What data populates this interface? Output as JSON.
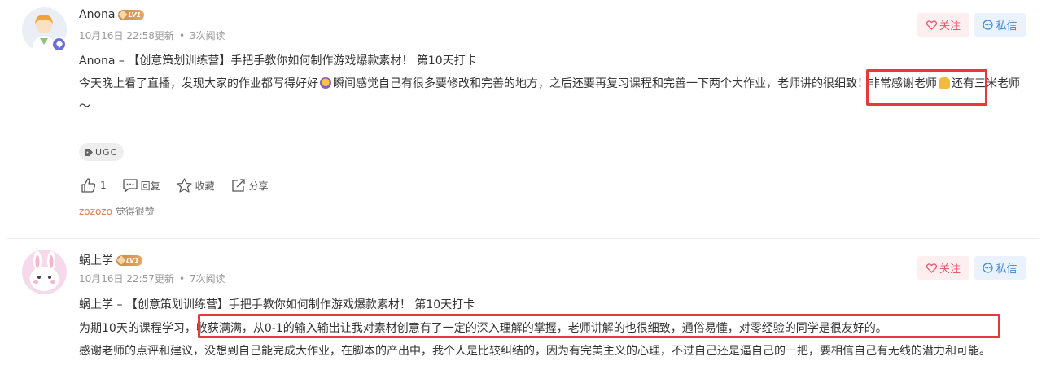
{
  "posts": [
    {
      "username": "Anona",
      "level": "LV1",
      "date": "10月16日 22:58更新",
      "reads": "3次阅读",
      "title": "Anona – 【创意策划训练营】手把手教你如何制作游戏爆款素材！ 第10天打卡",
      "body_part1": "今天晚上看了直播，发现大家的作业都写得好好",
      "body_part2": "瞬间感觉自己有很多要修改和完善的地方，之后还要再复习课程和完善一下两个大作业，",
      "body_highlight": "老师讲的很细致！",
      "body_part3": "非常感谢老师",
      "body_part4": "还有三米老师～",
      "tag": "UGC",
      "like_count": "1",
      "reply_label": "回复",
      "favorite_label": "收藏",
      "share_label": "分享",
      "liker": "zozozo",
      "liked_text": "觉得很赞",
      "follow_label": "关注",
      "message_label": "私信"
    },
    {
      "username": "蜗上学",
      "level": "LV1",
      "date": "10月16日 22:57更新",
      "reads": "7次阅读",
      "title": "蜗上学 – 【创意策划训练营】手把手教你如何制作游戏爆款素材！ 第10天打卡",
      "body_part1": "为期10天的课程学习，",
      "body_highlight": "收获满满，从0-1的输入输出让我对素材创意有了一定的深入理解的掌握，老师讲解的也很细致，通俗易懂，对零经验的同学是很友好的。",
      "body_part2": "感谢老师的点评和建议，没想到自己能完成大作业，在脚本的产出中，我个人是比较纠结的，因为有完美主义的心理，不过自己还是逼自己的一把，要相信自己有无线的潜力和可能。",
      "follow_label": "关注",
      "message_label": "私信"
    }
  ],
  "colors": {
    "highlight": "#e8383d",
    "follow": "#e95a6d",
    "message": "#3a86d6",
    "liker": "#e07a4f"
  }
}
